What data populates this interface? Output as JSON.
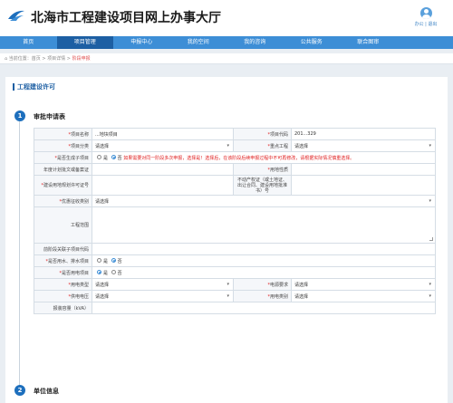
{
  "header": {
    "site_title": "北海市工程建设项目网上办事大厅",
    "user_links": "办公 | 退出"
  },
  "nav": {
    "items": [
      "首页",
      "项目管理",
      "申报中心",
      "我的空间",
      "我的咨询",
      "公共服务",
      "联合图审"
    ],
    "active_index": 1
  },
  "breadcrumb": {
    "prefix": "当前位置：",
    "home": "首页",
    "sep1": " > ",
    "detail": "项目详情",
    "sep2": " > ",
    "current": "阶段申报"
  },
  "section": {
    "title": "工程建设许可"
  },
  "step1": {
    "num": "1",
    "title": "审批申请表"
  },
  "step2": {
    "num": "2",
    "title": "单位信息"
  },
  "form": {
    "project_name_label": "项目名称",
    "project_name_value": "...地块项目",
    "project_code_label": "项目代码",
    "project_code_value": "201...329",
    "project_type_label": "项目分类",
    "select_placeholder": "请选择",
    "key_project_label": "重点工程",
    "subproject_label": "是否生成子项目",
    "opt_yes": "是",
    "opt_no": "否",
    "subproject_warning": "如果需要对同一阶段多次申报，选择是！选择后，在该阶段后续申报过程中不可再修改，请根据实际情况慎重选择。",
    "annual_plan_label": "年度计划批文或备案证",
    "land_nature_label": "用地性质",
    "land_permit_label": "建设用地规划许可证号",
    "realty_label": "不动产权证（或土地证、出让合同、建设用地批准书）号",
    "defense_label": "优惠征收类别",
    "scope_label": "工程范围",
    "prev_stage_label": "前阶段关联子项目代码",
    "water_label": "是否用水、排水项目",
    "electric_label": "是否用电项目",
    "elec_type_label": "用电类型",
    "power_req_label": "电源要求",
    "supply_voltage_label": "供电电压",
    "elec_category_label": "用电类别",
    "capacity_label": "报装容量（kVA）"
  }
}
